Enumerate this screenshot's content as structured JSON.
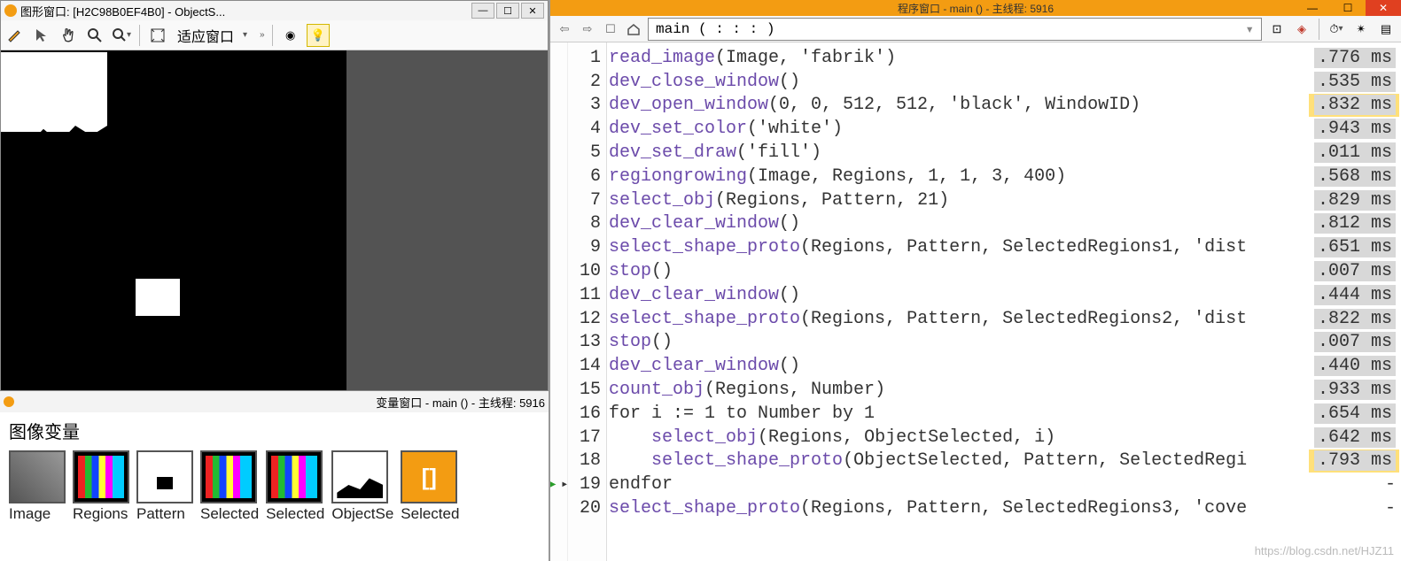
{
  "graphics": {
    "title": "图形窗口: [H2C98B0EF4B0] - ObjectS...",
    "fit_label": "适应窗口"
  },
  "var_window": {
    "title": "变量窗口 - main () - 主线程: 5916",
    "section_label": "图像变量"
  },
  "thumbs": [
    {
      "name": "Image"
    },
    {
      "name": "Regions"
    },
    {
      "name": "Pattern"
    },
    {
      "name": "Selected"
    },
    {
      "name": "Selected"
    },
    {
      "name": "ObjectSe"
    },
    {
      "name": "Selected"
    }
  ],
  "program": {
    "title": "程序窗口 - main () - 主线程: 5916",
    "proc": "main ( : : : )"
  },
  "code": [
    {
      "n": 1,
      "op": "read_image",
      "rest": " (Image, 'fabrik')",
      "t": ".776 ms"
    },
    {
      "n": 2,
      "op": "dev_close_window",
      "rest": " ()",
      "t": ".535 ms"
    },
    {
      "n": 3,
      "op": "dev_open_window",
      "rest": " (0, 0, 512, 512, 'black', WindowID)",
      "t": ".832 ms",
      "hl": true
    },
    {
      "n": 4,
      "op": "dev_set_color",
      "rest": " ('white')",
      "t": ".943 ms"
    },
    {
      "n": 5,
      "op": "dev_set_draw",
      "rest": " ('fill')",
      "t": ".011 ms"
    },
    {
      "n": 6,
      "op": "regiongrowing",
      "rest": " (Image, Regions, 1, 1, 3, 400)",
      "t": ".568 ms"
    },
    {
      "n": 7,
      "op": "select_obj",
      "rest": " (Regions, Pattern, 21)",
      "t": ".829 ms"
    },
    {
      "n": 8,
      "op": "dev_clear_window",
      "rest": " ()",
      "t": ".812 ms"
    },
    {
      "n": 9,
      "op": "select_shape_proto",
      "rest": " (Regions, Pattern, SelectedRegions1, 'dist",
      "t": ".651 ms"
    },
    {
      "n": 10,
      "op": "stop",
      "rest": " ()",
      "t": ".007 ms"
    },
    {
      "n": 11,
      "op": "dev_clear_window",
      "rest": " ()",
      "t": ".444 ms"
    },
    {
      "n": 12,
      "op": "select_shape_proto",
      "rest": " (Regions, Pattern, SelectedRegions2, 'dist",
      "t": ".822 ms"
    },
    {
      "n": 13,
      "op": "stop",
      "rest": " ()",
      "t": ".007 ms"
    },
    {
      "n": 14,
      "op": "dev_clear_window",
      "rest": " ()",
      "t": ".440 ms"
    },
    {
      "n": 15,
      "op": "count_obj",
      "rest": " (Regions, Number)",
      "t": ".933 ms"
    },
    {
      "n": 16,
      "op": "",
      "rest": "for i := 1 to Number by 1",
      "t": ".654 ms"
    },
    {
      "n": 17,
      "op": "select_obj",
      "rest": " (Regions, ObjectSelected, i)",
      "indent": true,
      "t": ".642 ms"
    },
    {
      "n": 18,
      "op": "select_shape_proto",
      "rest": " (ObjectSelected, Pattern, SelectedRegi",
      "indent": true,
      "t": ".793 ms",
      "hl": true
    },
    {
      "n": 19,
      "op": "",
      "rest": "endfor",
      "cur": true,
      "t": "-"
    },
    {
      "n": 20,
      "op": "select_shape_proto",
      "rest": " (Regions, Pattern, SelectedRegions3, 'cove",
      "t": "-"
    }
  ],
  "watermark": "https://blog.csdn.net/HJZ11"
}
